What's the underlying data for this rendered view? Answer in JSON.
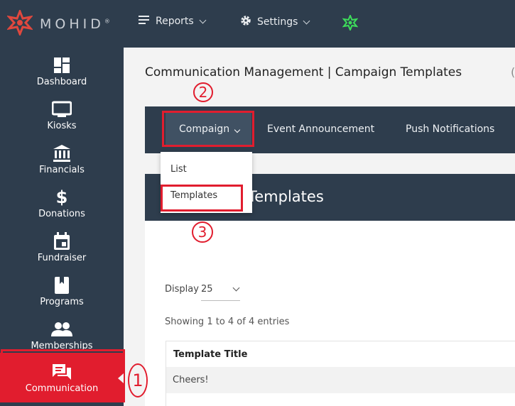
{
  "app": {
    "logo_text": "MOHID",
    "logo_mark": "®"
  },
  "topnav": {
    "reports_label": "Reports",
    "settings_label": "Settings"
  },
  "sidebar": {
    "items": [
      {
        "label": "Dashboard",
        "icon": "dashboard-icon"
      },
      {
        "label": "Kiosks",
        "icon": "monitor-icon"
      },
      {
        "label": "Financials",
        "icon": "bank-icon"
      },
      {
        "label": "Donations",
        "icon": "dollar-icon"
      },
      {
        "label": "Fundraiser",
        "icon": "calendar-icon"
      },
      {
        "label": "Programs",
        "icon": "book-icon"
      },
      {
        "label": "Memberships",
        "icon": "people-icon"
      },
      {
        "label": "Communication",
        "icon": "chat-icon",
        "active": true
      }
    ]
  },
  "page": {
    "title": "Communication Management | Campaign Templates"
  },
  "subnav": {
    "tabs": [
      {
        "label": "Compaign",
        "active": true
      },
      {
        "label": "Event Announcement"
      },
      {
        "label": "Push Notifications"
      }
    ]
  },
  "dropdown": {
    "items": [
      "List",
      "Templates"
    ]
  },
  "card": {
    "title": "Templates",
    "display_label": "Display",
    "display_value": "25",
    "showing_text": "Showing 1 to 4 of 4 entries",
    "column_header": "Template Title",
    "rows": [
      "Cheers!"
    ]
  },
  "callouts": {
    "one": "1",
    "two": "2",
    "three": "3"
  },
  "colors": {
    "navy": "#2e3d4d",
    "accent_red": "#e11d2e",
    "logo_red": "#e0483e",
    "green_icon": "#3ddc5a"
  }
}
